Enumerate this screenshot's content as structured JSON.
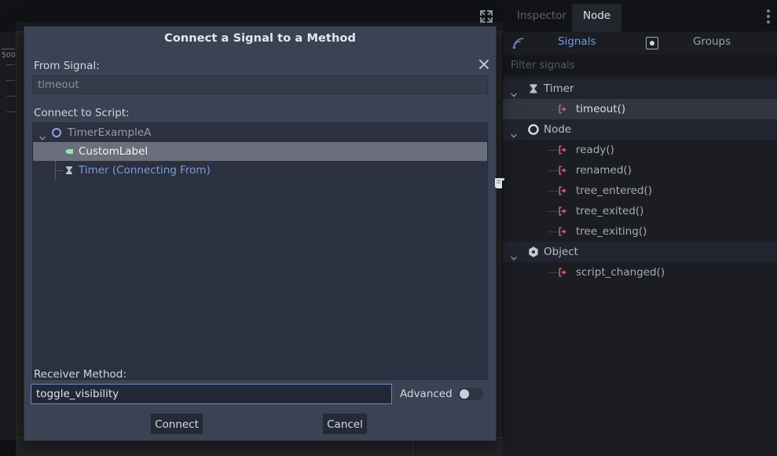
{
  "editor": {
    "ruler_label": "500",
    "expand_icon": "expand-icon"
  },
  "dock": {
    "tabs": [
      {
        "label": "Inspector",
        "active": false
      },
      {
        "label": "Node",
        "active": true
      }
    ],
    "menu_icon": "vertical-dots-icon",
    "subtabs": [
      {
        "label": "Signals",
        "active": true,
        "icon": "signal-broadcast-icon"
      },
      {
        "label": "Groups",
        "active": false,
        "icon": "group-radio-icon"
      }
    ],
    "filter": {
      "value": "",
      "placeholder": "Filter signals"
    },
    "signal_groups": [
      {
        "name": "Timer",
        "icon": "hourglass-icon",
        "expanded": true,
        "signals": [
          {
            "name": "timeout()",
            "selected": true,
            "icon": "signal-arrow-icon"
          }
        ]
      },
      {
        "name": "Node",
        "icon": "circle-icon",
        "expanded": true,
        "signals": [
          {
            "name": "ready()",
            "selected": false,
            "icon": "signal-arrow-icon"
          },
          {
            "name": "renamed()",
            "selected": false,
            "icon": "signal-arrow-icon"
          },
          {
            "name": "tree_entered()",
            "selected": false,
            "icon": "signal-arrow-icon"
          },
          {
            "name": "tree_exited()",
            "selected": false,
            "icon": "signal-arrow-icon"
          },
          {
            "name": "tree_exiting()",
            "selected": false,
            "icon": "signal-arrow-icon"
          }
        ]
      },
      {
        "name": "Object",
        "icon": "cube-icon",
        "expanded": true,
        "signals": [
          {
            "name": "script_changed()",
            "selected": false,
            "icon": "signal-arrow-icon"
          }
        ]
      }
    ]
  },
  "dialog": {
    "title": "Connect a Signal to a Method",
    "close_icon": "close-icon",
    "from_signal": {
      "label": "From Signal:",
      "value": "timeout"
    },
    "connect_to_script": {
      "label": "Connect to Script:",
      "nodes": [
        {
          "name": "TimerExampleA",
          "level": 0,
          "icon": "node2d-circle-icon",
          "selected": false,
          "expanded": true
        },
        {
          "name": "CustomLabel",
          "level": 1,
          "icon": "label-tag-icon",
          "selected": true,
          "has_script": true
        },
        {
          "name": "Timer (Connecting From)",
          "level": 1,
          "icon": "hourglass-icon",
          "selected": false,
          "link": true
        }
      ],
      "script_badge_icon": "script-icon"
    },
    "receiver_method": {
      "label": "Receiver Method:",
      "value": "toggle_visibility"
    },
    "advanced": {
      "label": "Advanced",
      "enabled": false
    },
    "buttons": {
      "connect": "Connect",
      "cancel": "Cancel"
    }
  }
}
